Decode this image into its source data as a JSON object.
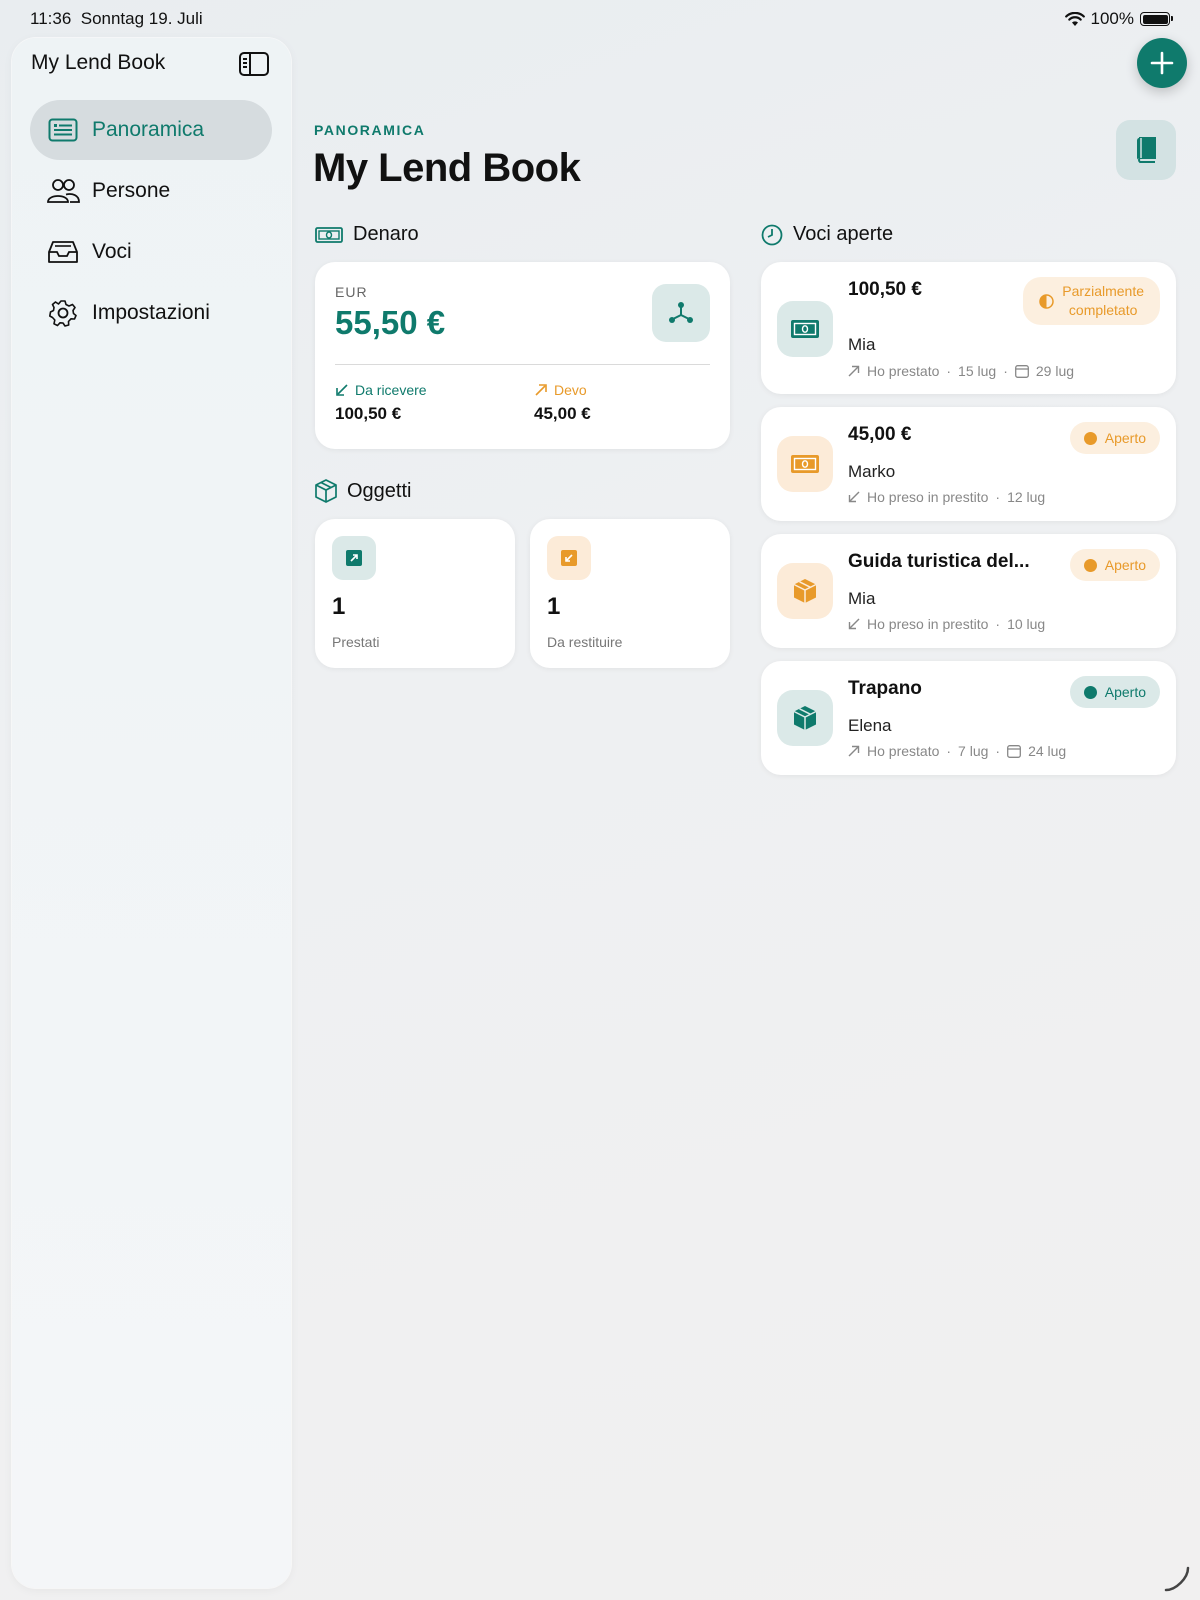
{
  "status": {
    "time": "11:36",
    "date": "Sonntag 19. Juli",
    "battery": "100%"
  },
  "sidebar": {
    "title": "My Lend Book",
    "items": [
      {
        "label": "Panoramica",
        "icon": "list-card-icon",
        "active": true
      },
      {
        "label": "Persone",
        "icon": "people-icon",
        "active": false
      },
      {
        "label": "Voci",
        "icon": "tray-icon",
        "active": false
      },
      {
        "label": "Impostazioni",
        "icon": "gear-icon",
        "active": false
      }
    ]
  },
  "header": {
    "eyebrow": "PANORAMICA",
    "title": "My Lend Book"
  },
  "money": {
    "heading": "Denaro",
    "currency": "EUR",
    "balance": "55,50 €",
    "receive_label": "Da ricevere",
    "receive_amount": "100,50 €",
    "owe_label": "Devo",
    "owe_amount": "45,00 €"
  },
  "objects": {
    "heading": "Oggetti",
    "lent_count": "1",
    "lent_label": "Prestati",
    "return_count": "1",
    "return_label": "Da restituire"
  },
  "open_entries": {
    "heading": "Voci aperte",
    "items": [
      {
        "title": "100,50 €",
        "person": "Mia",
        "direction": "Ho prestato",
        "date": "15 lug",
        "due": "29 lug",
        "status": "Parzialmente completato",
        "status_line1": "Parzialmente",
        "status_line2": "completato",
        "kind": "money"
      },
      {
        "title": "45,00 €",
        "person": "Marko",
        "direction": "Ho preso in prestito",
        "date": "12 lug",
        "due": "",
        "status": "Aperto",
        "kind": "money"
      },
      {
        "title": "Guida turistica del...",
        "person": "Mia",
        "direction": "Ho preso in prestito",
        "date": "10 lug",
        "due": "",
        "status": "Aperto",
        "kind": "object"
      },
      {
        "title": "Trapano",
        "person": "Elena",
        "direction": "Ho prestato",
        "date": "7 lug",
        "due": "24 lug",
        "status": "Aperto",
        "kind": "object"
      }
    ]
  },
  "colors": {
    "accent": "#0f7a6c",
    "warning": "#e89a2a",
    "active_bg": "#d6dcdf"
  }
}
